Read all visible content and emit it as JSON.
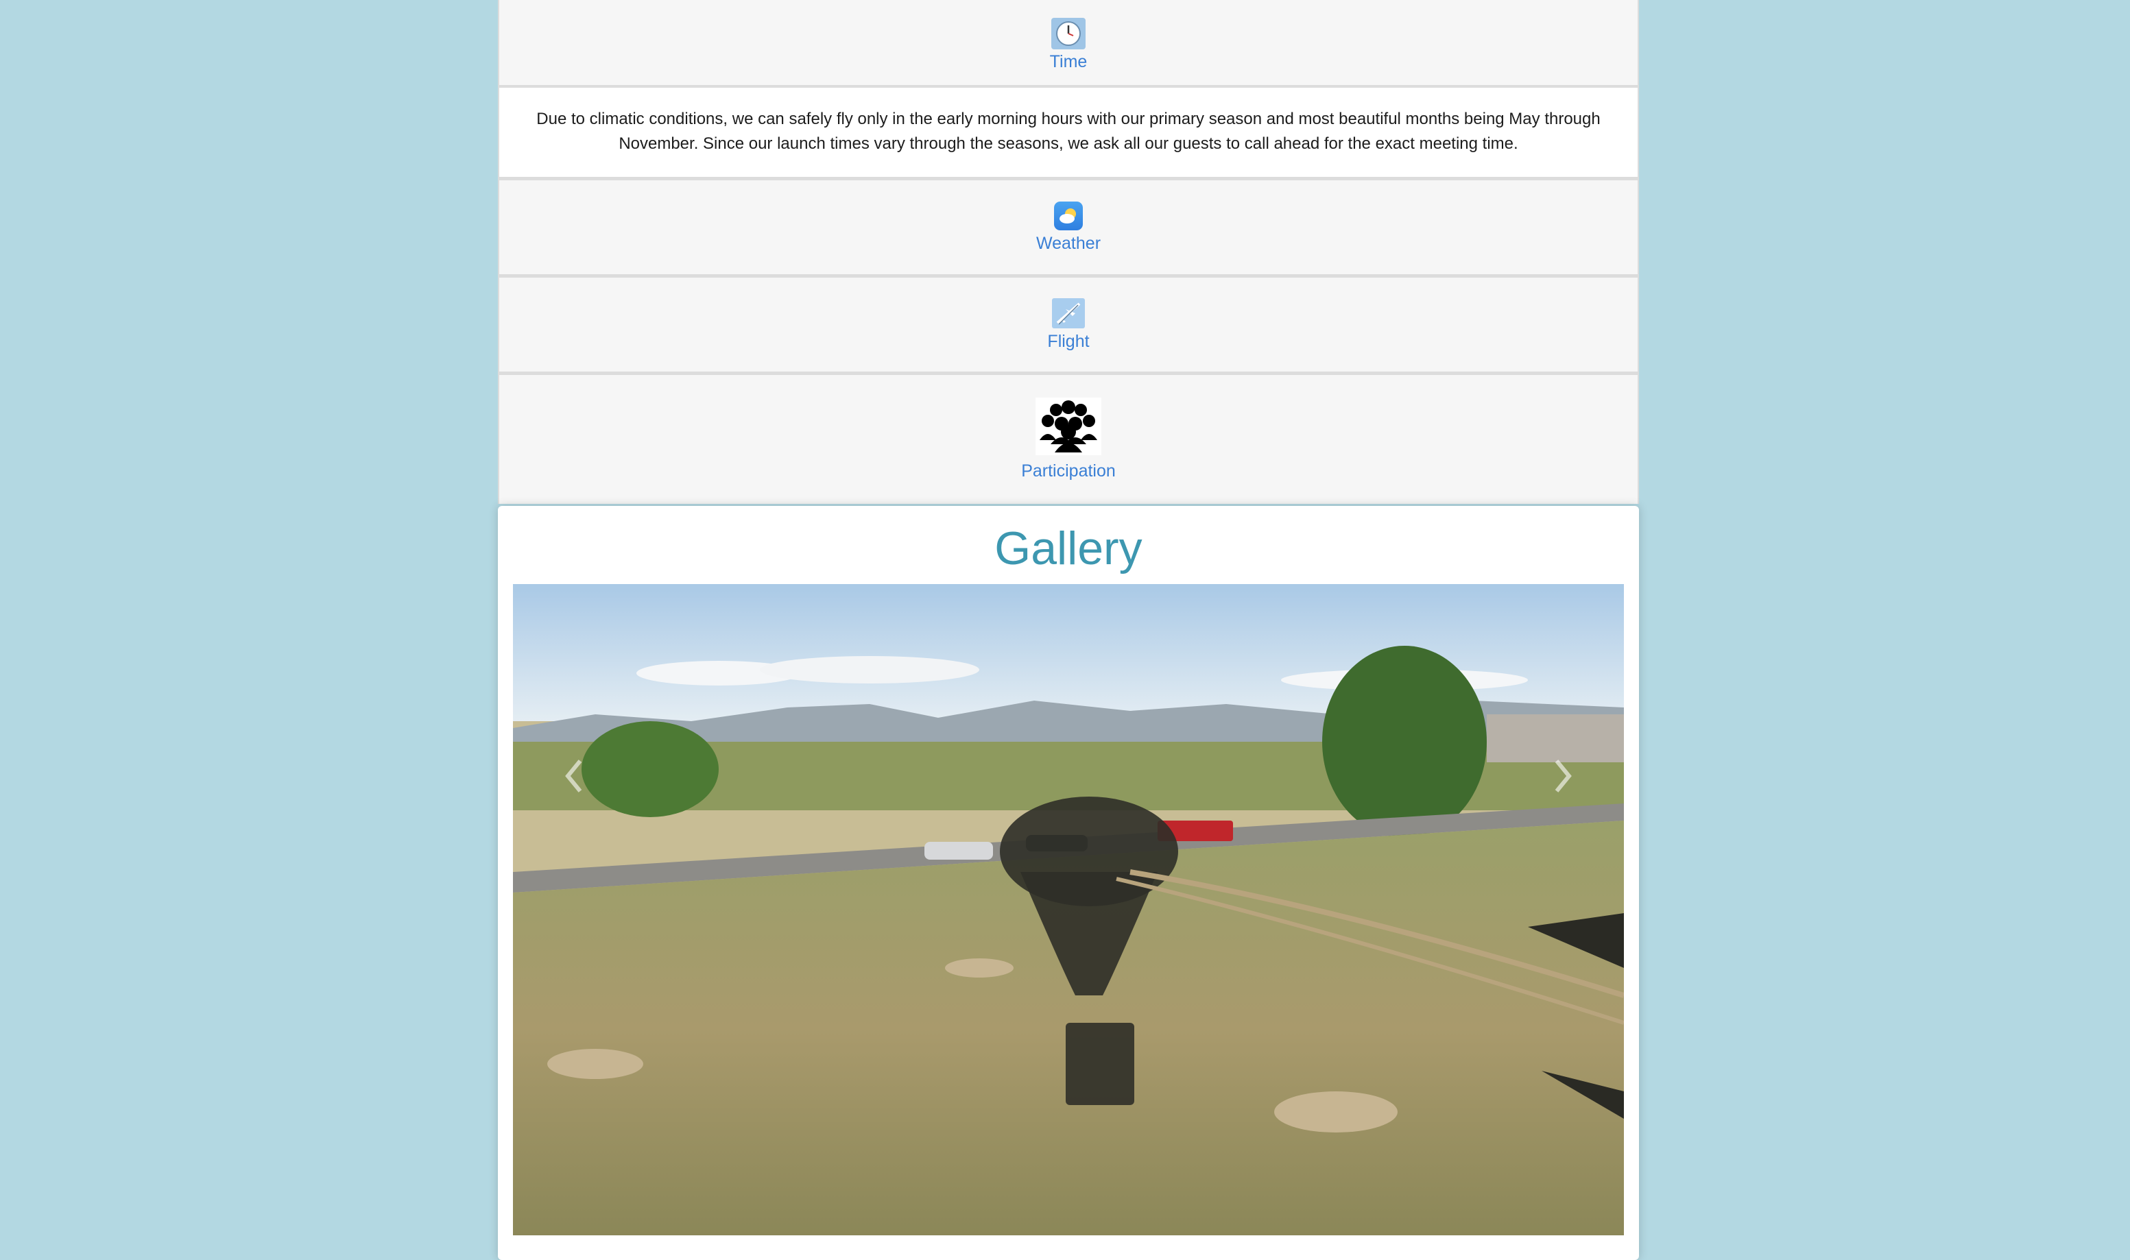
{
  "time": {
    "label": "Time",
    "icon": "clock-icon"
  },
  "time_description": "Due to climatic conditions, we can safely fly only in the early morning hours with our primary season and most beautiful months being May through November. Since our launch times vary through the seasons, we ask all our guests to call ahead for the exact meeting time.",
  "weather": {
    "label": "Weather",
    "icon": "weather-icon"
  },
  "flight": {
    "label": "Flight",
    "icon": "airplane-icon"
  },
  "participation": {
    "label": "Participation",
    "icon": "group-people-icon"
  },
  "gallery": {
    "title": "Gallery",
    "image_alt": "balloon-shadow-over-field-photo",
    "prev_icon": "chevron-left-icon",
    "next_icon": "chevron-right-icon"
  },
  "colors": {
    "background": "#b3d8e2",
    "link": "#3a7fd5",
    "gallery_title": "#3d97b0"
  }
}
